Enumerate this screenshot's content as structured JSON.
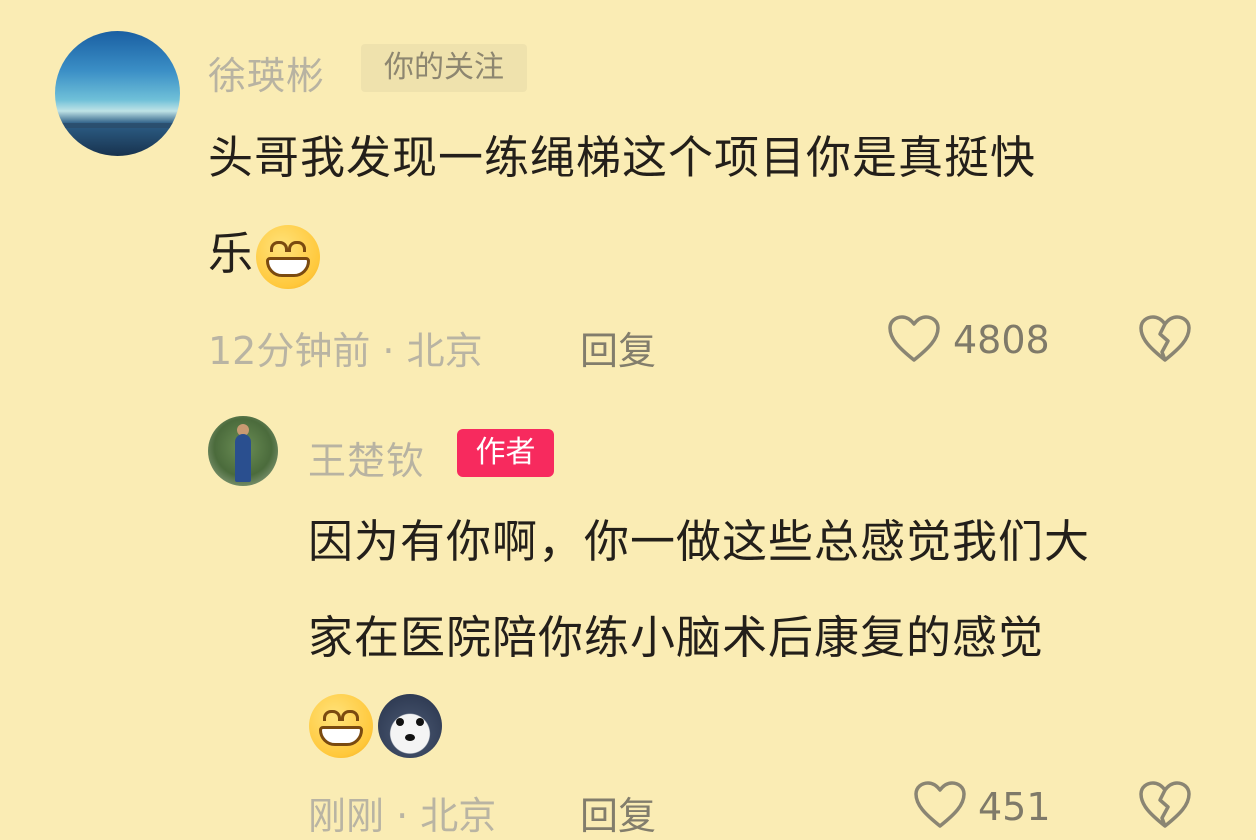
{
  "comment": {
    "username": "徐瑛彬",
    "follow_badge": "你的关注",
    "text_line1": "头哥我发现一练绳梯这个项目你是真挺快",
    "text_line2": "乐",
    "meta": "12分钟前 · 北京",
    "reply_label": "回复",
    "like_count": "4808"
  },
  "reply": {
    "username": "王楚钦",
    "author_badge": "作者",
    "text_line1": "因为有你啊，你一做这些总感觉我们大",
    "text_line2": "家在医院陪你练小脑术后康复的感觉",
    "meta": "刚刚 · 北京",
    "reply_label": "回复",
    "like_count": "451"
  },
  "icons": {
    "like": "heart-outline-icon",
    "dislike": "broken-heart-icon",
    "emoji_grin": "grinning-face-emoji",
    "emoji_dog": "husky-dog-emoji"
  },
  "colors": {
    "background": "#faecb4",
    "author_badge": "#f72a5e"
  }
}
